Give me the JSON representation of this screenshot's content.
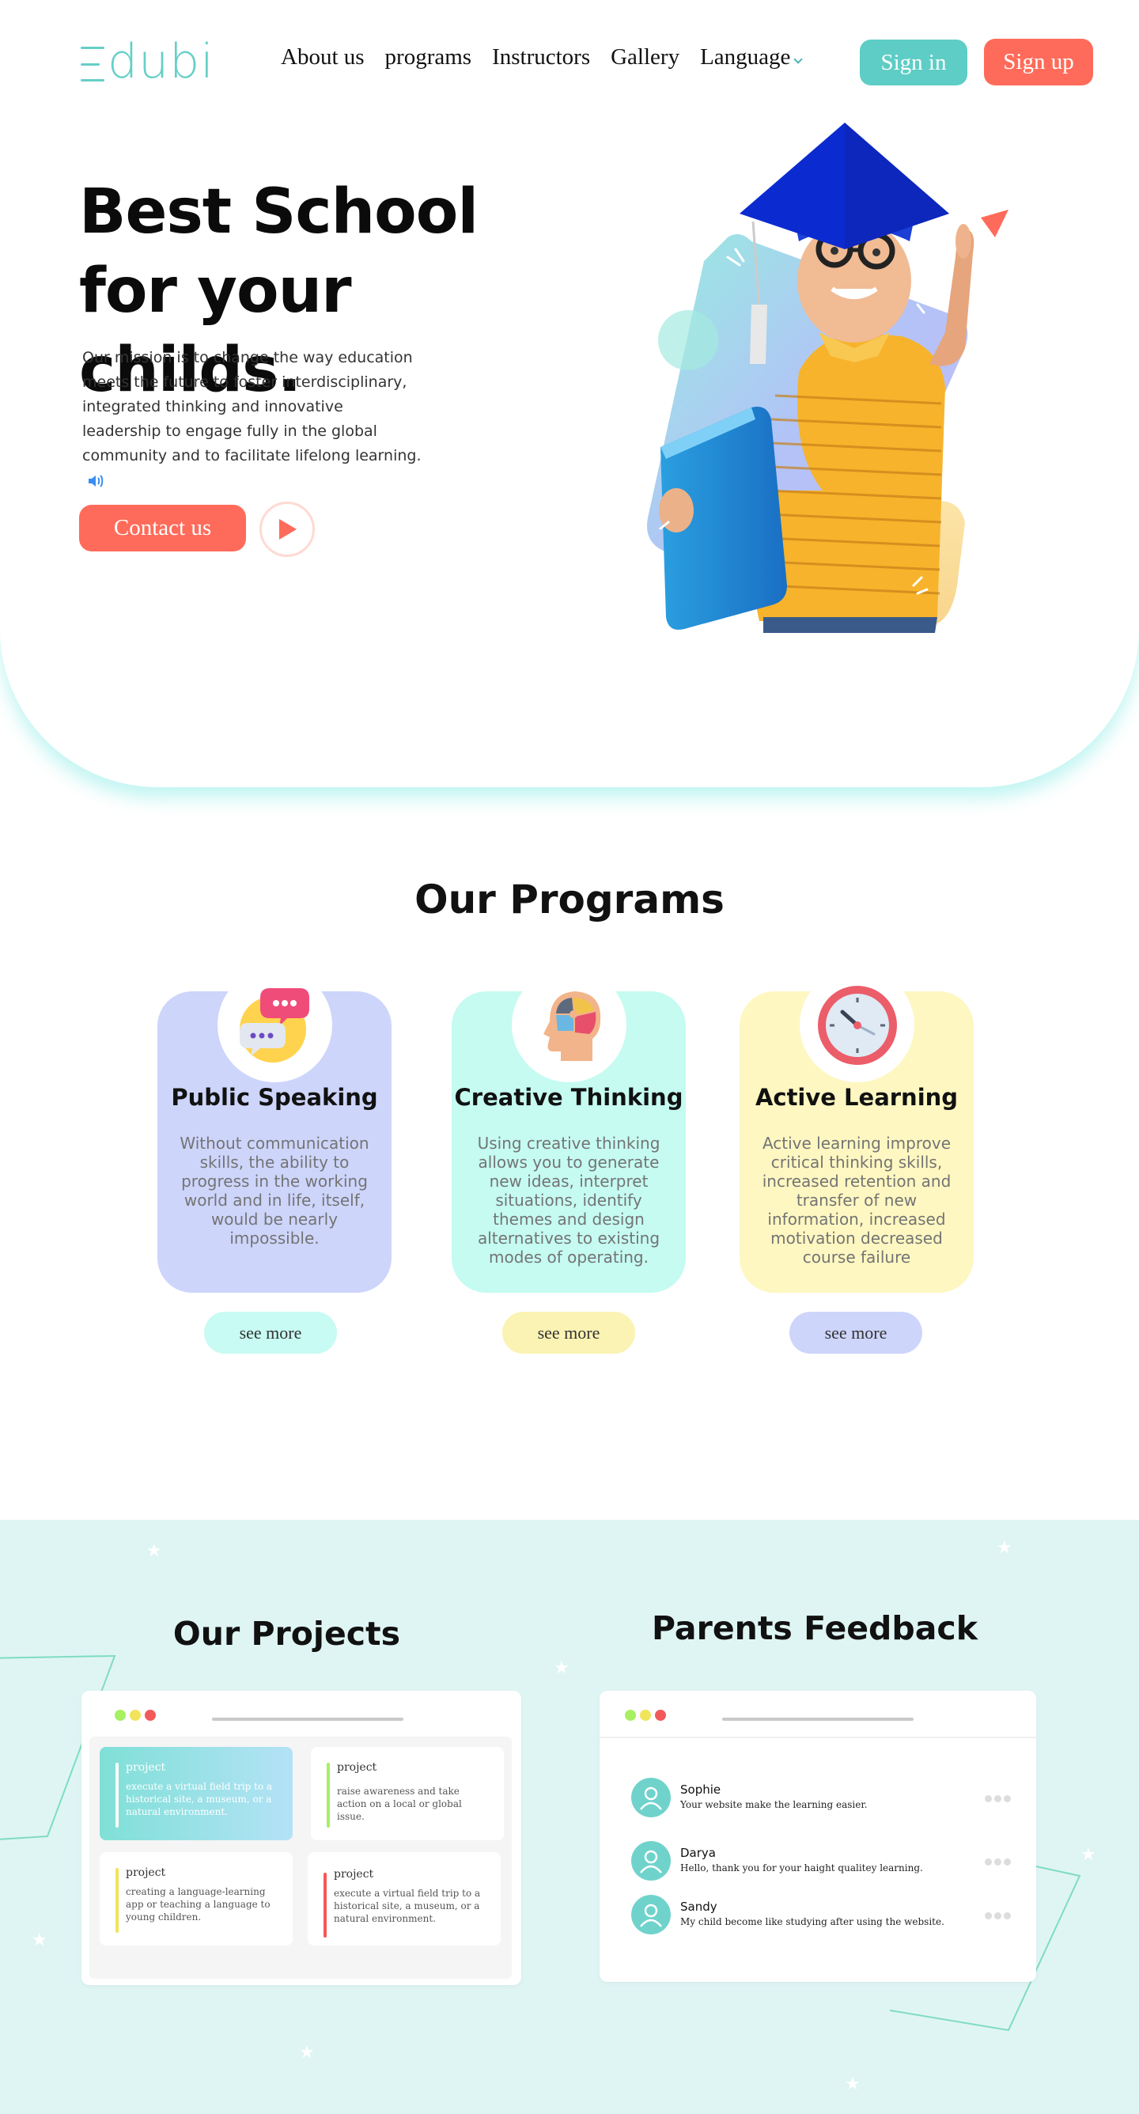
{
  "header": {
    "logo": "dubi",
    "nav": [
      "About us",
      "programs",
      "Instructors",
      "Gallery",
      "Language"
    ],
    "sign_in": "Sign in",
    "sign_up": "Sign up"
  },
  "hero": {
    "title": "Best School for your childs.",
    "description": "Our mission is to change the way education meets the future to foster interdisciplinary, integrated thinking and innovative leadership to engage fully in the global community and to facilitate lifelong learning.",
    "contact_button": "Contact us"
  },
  "programs": {
    "title": "Our Programs",
    "cards": [
      {
        "title": "Public Speaking",
        "text": "Without communication skills, the ability to progress in the working world and in life, itself, would be nearly impossible.",
        "button": "see more"
      },
      {
        "title": "Creative Thinking",
        "text": "Using creative thinking allows you to generate new ideas, interpret situations, identify themes and design alternatives to existing modes of operating.",
        "button": "see more"
      },
      {
        "title": "Active Learning",
        "text": "Active learning improve critical thinking skills, increased retention and transfer of new information, increased motivation decreased course failure",
        "button": "see more"
      }
    ]
  },
  "projects": {
    "title": "Our Projects",
    "items": [
      {
        "label": "project",
        "text": "execute a virtual field trip to a historical site, a museum, or a natural environment."
      },
      {
        "label": "project",
        "text": "raise awareness and take action on a local or global issue."
      },
      {
        "label": "project",
        "text": "creating a language-learning app or teaching a language to young children."
      },
      {
        "label": "project",
        "text": "execute a virtual field trip to a historical site, a museum, or a natural environment."
      }
    ]
  },
  "feedback": {
    "title": "Parents Feedback",
    "items": [
      {
        "name": "Sophie",
        "message": "Your website make the learning easier."
      },
      {
        "name": "Darya",
        "message": "Hello, thank you for your haight qualitey learning."
      },
      {
        "name": "Sandy",
        "message": "My child become like studying after using the website."
      }
    ]
  },
  "colors": {
    "teal": "#5ecdc5",
    "coral": "#ff6b5a",
    "lavender": "#cdd5fb",
    "mint": "#c5fbf1",
    "lemon": "#fef7c1",
    "bottom_bg": "#dff5f4"
  },
  "icons": [
    "speaker-icon",
    "play-icon",
    "chat-bubbles-icon",
    "puzzle-head-icon",
    "clock-icon",
    "user-avatar-icon",
    "more-dots-icon",
    "star-icon"
  ]
}
